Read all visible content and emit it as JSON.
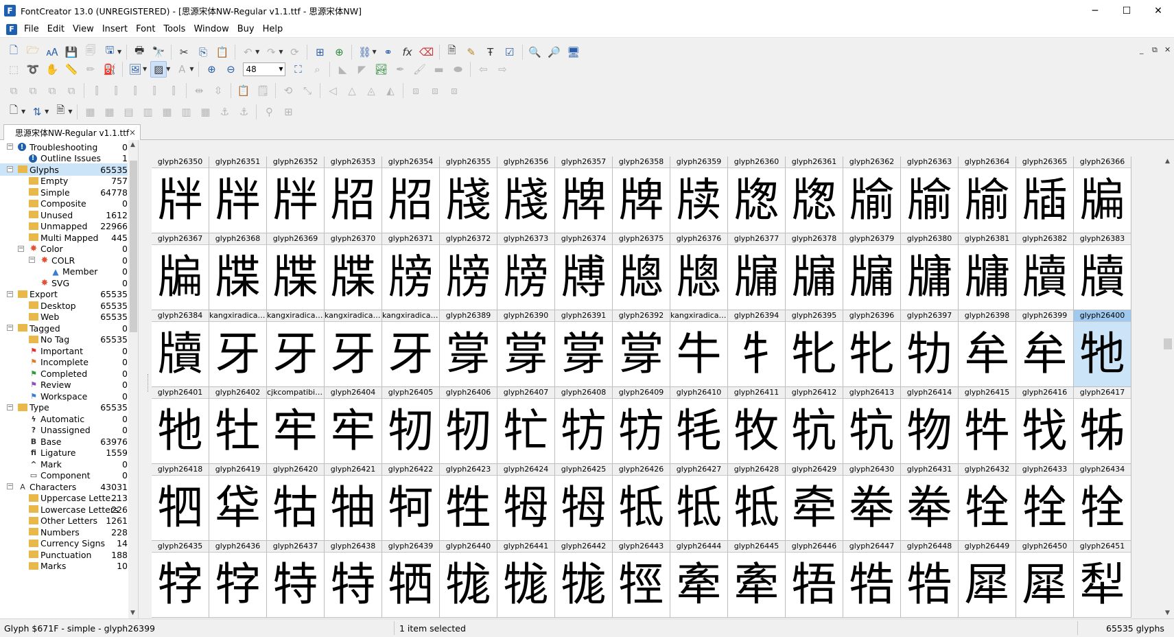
{
  "window": {
    "title": "FontCreator 13.0 (UNREGISTERED) - [思源宋体NW-Regular v1.1.ttf - 思源宋体NW]",
    "minimize": "─",
    "maximize": "☐",
    "close": "✕"
  },
  "menu": {
    "items": [
      "File",
      "Edit",
      "View",
      "Insert",
      "Font",
      "Tools",
      "Window",
      "Buy",
      "Help"
    ],
    "mdi_controls": [
      "_",
      "⧉",
      "✕"
    ]
  },
  "toolbar": {
    "zoom_value": "48"
  },
  "tab": {
    "label": "思源宋体NW-Regular v1.1.ttf",
    "close": "×"
  },
  "tree": {
    "items": [
      {
        "indent": 0,
        "exp": "−",
        "icon": "warning",
        "label": "Troubleshooting",
        "count": "0"
      },
      {
        "indent": 1,
        "icon": "warning",
        "label": "Outline Issues",
        "count": "1"
      },
      {
        "indent": 0,
        "exp": "−",
        "icon": "folder",
        "label": "Glyphs",
        "count": "65535",
        "selected": true
      },
      {
        "indent": 1,
        "icon": "folder",
        "label": "Empty",
        "count": "757"
      },
      {
        "indent": 1,
        "icon": "folder",
        "label": "Simple",
        "count": "64778"
      },
      {
        "indent": 1,
        "icon": "folder",
        "label": "Composite",
        "count": "0"
      },
      {
        "indent": 1,
        "icon": "folder",
        "label": "Unused",
        "count": "1612"
      },
      {
        "indent": 1,
        "icon": "folder",
        "label": "Unmapped",
        "count": "22966"
      },
      {
        "indent": 1,
        "icon": "folder",
        "label": "Multi Mapped",
        "count": "445"
      },
      {
        "indent": 1,
        "exp": "−",
        "icon": "color",
        "label": "Color",
        "count": "0"
      },
      {
        "indent": 2,
        "exp": "−",
        "icon": "color",
        "label": "COLR",
        "count": "0"
      },
      {
        "indent": 3,
        "icon": "triangle",
        "label": "Member",
        "count": "0"
      },
      {
        "indent": 2,
        "icon": "color",
        "label": "SVG",
        "count": "0"
      },
      {
        "indent": 0,
        "exp": "−",
        "icon": "folder",
        "label": "Export",
        "count": "65535"
      },
      {
        "indent": 1,
        "icon": "folder",
        "label": "Desktop",
        "count": "65535"
      },
      {
        "indent": 1,
        "icon": "folder",
        "label": "Web",
        "count": "65535"
      },
      {
        "indent": 0,
        "exp": "−",
        "icon": "folder",
        "label": "Tagged",
        "count": "0"
      },
      {
        "indent": 1,
        "icon": "folder",
        "label": "No Tag",
        "count": "65535"
      },
      {
        "indent": 1,
        "icon": "flag-red",
        "label": "Important",
        "count": "0"
      },
      {
        "indent": 1,
        "icon": "flag-orange",
        "label": "Incomplete",
        "count": "0"
      },
      {
        "indent": 1,
        "icon": "flag-green",
        "label": "Completed",
        "count": "0"
      },
      {
        "indent": 1,
        "icon": "flag-purple",
        "label": "Review",
        "count": "0"
      },
      {
        "indent": 1,
        "icon": "flag-blue",
        "label": "Workspace",
        "count": "0"
      },
      {
        "indent": 0,
        "exp": "−",
        "icon": "folder",
        "label": "Type",
        "count": "65535"
      },
      {
        "indent": 1,
        "icon": "lightning",
        "label": "Automatic",
        "count": "0"
      },
      {
        "indent": 1,
        "icon": "question",
        "label": "Unassigned",
        "count": "0"
      },
      {
        "indent": 1,
        "icon": "B",
        "label": "Base",
        "count": "63976"
      },
      {
        "indent": 1,
        "icon": "fi",
        "label": "Ligature",
        "count": "1559"
      },
      {
        "indent": 1,
        "icon": "^",
        "label": "Mark",
        "count": "0"
      },
      {
        "indent": 1,
        "icon": "component",
        "label": "Component",
        "count": "0"
      },
      {
        "indent": 0,
        "exp": "−",
        "icon": "A",
        "label": "Characters",
        "count": "43031"
      },
      {
        "indent": 1,
        "icon": "folder",
        "label": "Uppercase Lette...",
        "count": "213"
      },
      {
        "indent": 1,
        "icon": "folder",
        "label": "Lowercase Letters",
        "count": "226"
      },
      {
        "indent": 1,
        "icon": "folder",
        "label": "Other Letters",
        "count": "1261"
      },
      {
        "indent": 1,
        "icon": "folder",
        "label": "Numbers",
        "count": "228"
      },
      {
        "indent": 1,
        "icon": "folder",
        "label": "Currency Signs",
        "count": "14"
      },
      {
        "indent": 1,
        "icon": "folder",
        "label": "Punctuation",
        "count": "188"
      },
      {
        "indent": 1,
        "icon": "folder",
        "label": "Marks",
        "count": "10"
      }
    ]
  },
  "grid": {
    "selected_index": 50,
    "cells": [
      {
        "name": "glyph26350",
        "char": "牉"
      },
      {
        "name": "glyph26351",
        "char": "牉"
      },
      {
        "name": "glyph26352",
        "char": "牉"
      },
      {
        "name": "glyph26353",
        "char": "牊"
      },
      {
        "name": "glyph26354",
        "char": "牊"
      },
      {
        "name": "glyph26355",
        "char": "牋"
      },
      {
        "name": "glyph26356",
        "char": "牋"
      },
      {
        "name": "glyph26357",
        "char": "牌"
      },
      {
        "name": "glyph26358",
        "char": "牌"
      },
      {
        "name": "glyph26359",
        "char": "牍"
      },
      {
        "name": "glyph26360",
        "char": "牎"
      },
      {
        "name": "glyph26361",
        "char": "牎"
      },
      {
        "name": "glyph26362",
        "char": "牏"
      },
      {
        "name": "glyph26363",
        "char": "牏"
      },
      {
        "name": "glyph26364",
        "char": "牏"
      },
      {
        "name": "glyph26365",
        "char": "牐"
      },
      {
        "name": "glyph26366",
        "char": "牑"
      },
      {
        "name": "glyph26367",
        "char": "牑"
      },
      {
        "name": "glyph26368",
        "char": "牒"
      },
      {
        "name": "glyph26369",
        "char": "牒"
      },
      {
        "name": "glyph26370",
        "char": "牒"
      },
      {
        "name": "glyph26371",
        "char": "牓"
      },
      {
        "name": "glyph26372",
        "char": "牓"
      },
      {
        "name": "glyph26373",
        "char": "牓"
      },
      {
        "name": "glyph26374",
        "char": "牔"
      },
      {
        "name": "glyph26375",
        "char": "牕"
      },
      {
        "name": "glyph26376",
        "char": "牕"
      },
      {
        "name": "glyph26377",
        "char": "牖"
      },
      {
        "name": "glyph26378",
        "char": "牖"
      },
      {
        "name": "glyph26379",
        "char": "牖"
      },
      {
        "name": "glyph26380",
        "char": "牗"
      },
      {
        "name": "glyph26381",
        "char": "牗"
      },
      {
        "name": "glyph26382",
        "char": "牘"
      },
      {
        "name": "glyph26383",
        "char": "牘"
      },
      {
        "name": "glyph26384",
        "char": "牘"
      },
      {
        "name": "kangxiradical...",
        "char": "牙"
      },
      {
        "name": "kangxiradical...",
        "char": "牙"
      },
      {
        "name": "kangxiradical...",
        "char": "牙"
      },
      {
        "name": "kangxiradical...",
        "char": "牙"
      },
      {
        "name": "glyph26389",
        "char": "牚"
      },
      {
        "name": "glyph26390",
        "char": "牚"
      },
      {
        "name": "glyph26391",
        "char": "牚"
      },
      {
        "name": "glyph26392",
        "char": "牚"
      },
      {
        "name": "kangxiradical...",
        "char": "牛"
      },
      {
        "name": "glyph26394",
        "char": "牜"
      },
      {
        "name": "glyph26395",
        "char": "牝"
      },
      {
        "name": "glyph26396",
        "char": "牝"
      },
      {
        "name": "glyph26397",
        "char": "牞"
      },
      {
        "name": "glyph26398",
        "char": "牟"
      },
      {
        "name": "glyph26399",
        "char": "牟"
      },
      {
        "name": "glyph26400",
        "char": "牠"
      },
      {
        "name": "glyph26401",
        "char": "牠"
      },
      {
        "name": "glyph26402",
        "char": "牡"
      },
      {
        "name": "cjkcompatibil...",
        "char": "牢"
      },
      {
        "name": "glyph26404",
        "char": "牢"
      },
      {
        "name": "glyph26405",
        "char": "牣"
      },
      {
        "name": "glyph26406",
        "char": "牣"
      },
      {
        "name": "glyph26407",
        "char": "牤"
      },
      {
        "name": "glyph26408",
        "char": "牥"
      },
      {
        "name": "glyph26409",
        "char": "牥"
      },
      {
        "name": "glyph26410",
        "char": "牦"
      },
      {
        "name": "glyph26411",
        "char": "牧"
      },
      {
        "name": "glyph26412",
        "char": "牨"
      },
      {
        "name": "glyph26413",
        "char": "牨"
      },
      {
        "name": "glyph26414",
        "char": "物"
      },
      {
        "name": "glyph26415",
        "char": "牪"
      },
      {
        "name": "glyph26416",
        "char": "牫"
      },
      {
        "name": "glyph26417",
        "char": "牬"
      },
      {
        "name": "glyph26418",
        "char": "牭"
      },
      {
        "name": "glyph26419",
        "char": "牮"
      },
      {
        "name": "glyph26420",
        "char": "牯"
      },
      {
        "name": "glyph26421",
        "char": "牰"
      },
      {
        "name": "glyph26422",
        "char": "牱"
      },
      {
        "name": "glyph26423",
        "char": "牲"
      },
      {
        "name": "glyph26424",
        "char": "牳"
      },
      {
        "name": "glyph26425",
        "char": "牳"
      },
      {
        "name": "glyph26426",
        "char": "牴"
      },
      {
        "name": "glyph26427",
        "char": "牴"
      },
      {
        "name": "glyph26428",
        "char": "牴"
      },
      {
        "name": "glyph26429",
        "char": "牵"
      },
      {
        "name": "glyph26430",
        "char": "牶"
      },
      {
        "name": "glyph26431",
        "char": "牶"
      },
      {
        "name": "glyph26432",
        "char": "牷"
      },
      {
        "name": "glyph26433",
        "char": "牷"
      },
      {
        "name": "glyph26434",
        "char": "牷"
      },
      {
        "name": "glyph26435",
        "char": "牸"
      },
      {
        "name": "glyph26436",
        "char": "牸"
      },
      {
        "name": "glyph26437",
        "char": "特"
      },
      {
        "name": "glyph26438",
        "char": "特"
      },
      {
        "name": "glyph26439",
        "char": "牺"
      },
      {
        "name": "glyph26440",
        "char": "牻"
      },
      {
        "name": "glyph26441",
        "char": "牻"
      },
      {
        "name": "glyph26442",
        "char": "牻"
      },
      {
        "name": "glyph26443",
        "char": "牼"
      },
      {
        "name": "glyph26444",
        "char": "牽"
      },
      {
        "name": "glyph26445",
        "char": "牽"
      },
      {
        "name": "glyph26446",
        "char": "牾"
      },
      {
        "name": "glyph26447",
        "char": "牿"
      },
      {
        "name": "glyph26448",
        "char": "牿"
      },
      {
        "name": "glyph26449",
        "char": "犀"
      },
      {
        "name": "glyph26450",
        "char": "犀"
      },
      {
        "name": "glyph26451",
        "char": "犁"
      }
    ]
  },
  "status": {
    "left": "Glyph $671F - simple - glyph26399",
    "middle": "1 item selected",
    "right": "65535 glyphs"
  }
}
